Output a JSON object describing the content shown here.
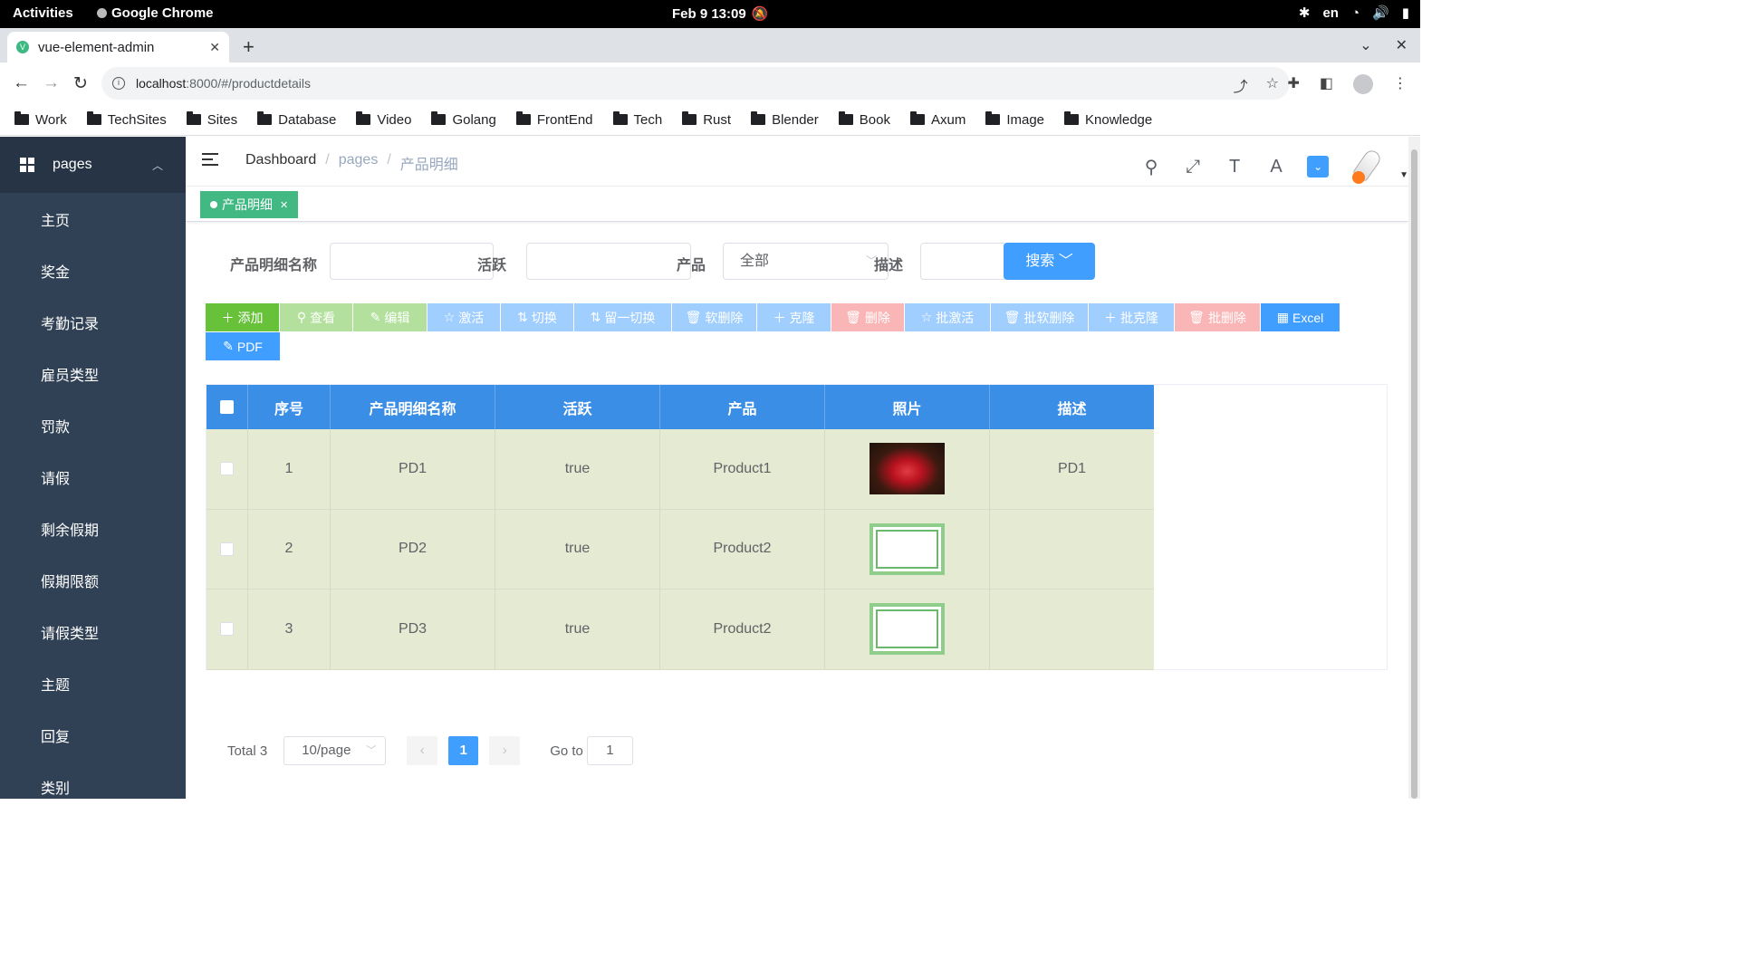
{
  "os": {
    "activities": "Activities",
    "app_name": "Google Chrome",
    "clock": "Feb 9  13:09",
    "lang": "en"
  },
  "browser": {
    "tab_title": "vue-element-admin",
    "url_host": "localhost",
    "url_path": ":8000/#/productdetails",
    "bookmarks": [
      "Work",
      "TechSites",
      "Sites",
      "Database",
      "Video",
      "Golang",
      "FrontEnd",
      "Tech",
      "Rust",
      "Blender",
      "Book",
      "Axum",
      "Image",
      "Knowledge"
    ]
  },
  "sidebar": {
    "group_label": "pages",
    "items": [
      "主页",
      "奖金",
      "考勤记录",
      "雇员类型",
      "罚款",
      "请假",
      "剩余假期",
      "假期限额",
      "请假类型",
      "主题",
      "回复",
      "类别"
    ]
  },
  "breadcrumb": [
    "Dashboard",
    "pages",
    "产品明细"
  ],
  "tags_view": {
    "active_tag": "产品明细"
  },
  "filter": {
    "name_label": "产品明细名称",
    "active_label": "活跃",
    "product_label": "产品",
    "product_value": "全部",
    "desc_label": "描述",
    "search_button": "搜索"
  },
  "toolbar": {
    "add": "添加",
    "view": "查看",
    "edit": "编辑",
    "activate": "激活",
    "toggle": "切换",
    "keep_one_toggle": "留一切换",
    "soft_delete": "软删除",
    "clone": "克隆",
    "delete": "删除",
    "batch_activate": "批激活",
    "batch_soft_delete": "批软删除",
    "batch_clone": "批克隆",
    "batch_delete": "批删除",
    "excel": "Excel",
    "pdf": "PDF"
  },
  "table": {
    "headers": [
      "序号",
      "产品明细名称",
      "活跃",
      "产品",
      "照片",
      "描述"
    ],
    "rows": [
      {
        "index": "1",
        "name": "PD1",
        "active": "true",
        "product": "Product1",
        "photo": "red-flower",
        "description": "PD1"
      },
      {
        "index": "2",
        "name": "PD2",
        "active": "true",
        "product": "Product2",
        "photo": "floral-frame",
        "description": ""
      },
      {
        "index": "3",
        "name": "PD3",
        "active": "true",
        "product": "Product2",
        "photo": "floral-frame",
        "description": ""
      }
    ]
  },
  "pagination": {
    "total": "Total 3",
    "page_size": "10/page",
    "current_page": "1",
    "goto_label": "Go to",
    "goto_value": "1"
  },
  "colors": {
    "sidebar_bg": "#304156",
    "header_blue": "#3a8ee6",
    "row_bg": "#e5ead3",
    "tag_green": "#42b983",
    "primary": "#409eff"
  }
}
